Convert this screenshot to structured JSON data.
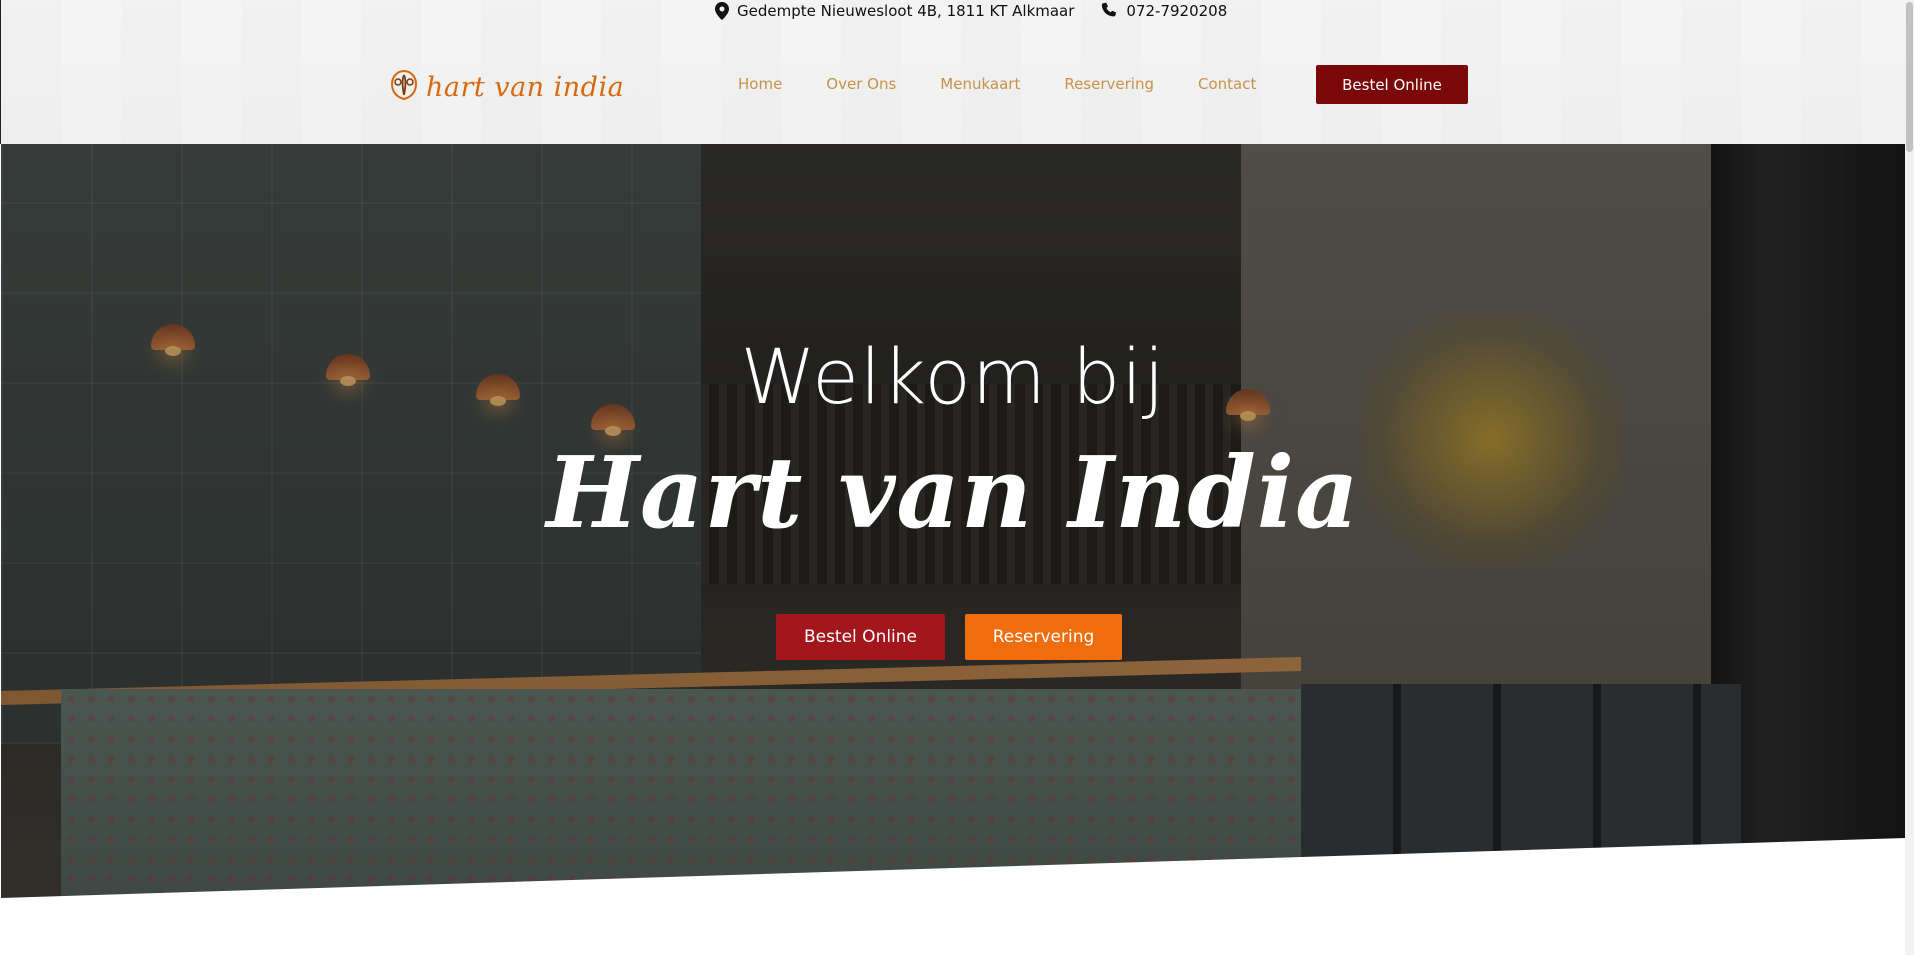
{
  "topbar": {
    "address": "Gedempte Nieuwesloot 4B, 1811 KT Alkmaar",
    "phone": "072-7920208"
  },
  "logo": {
    "text": "hart van india"
  },
  "nav": {
    "items": [
      {
        "label": "Home"
      },
      {
        "label": "Over Ons"
      },
      {
        "label": "Menukaart"
      },
      {
        "label": "Reservering"
      },
      {
        "label": "Contact"
      }
    ],
    "order_button": "Bestel Online"
  },
  "hero": {
    "welcome": "Welkom bij",
    "brand": "Hart van India",
    "order_button": "Bestel Online",
    "reserve_button": "Reservering"
  },
  "colors": {
    "logo_orange": "#d9680f",
    "nav_text": "#c9924a",
    "top_button": "#7a0808",
    "hero_order": "#a3171c",
    "hero_reserve": "#f06d0d"
  },
  "icons": [
    "location-pin-icon",
    "phone-icon",
    "logo-emblem-icon"
  ]
}
